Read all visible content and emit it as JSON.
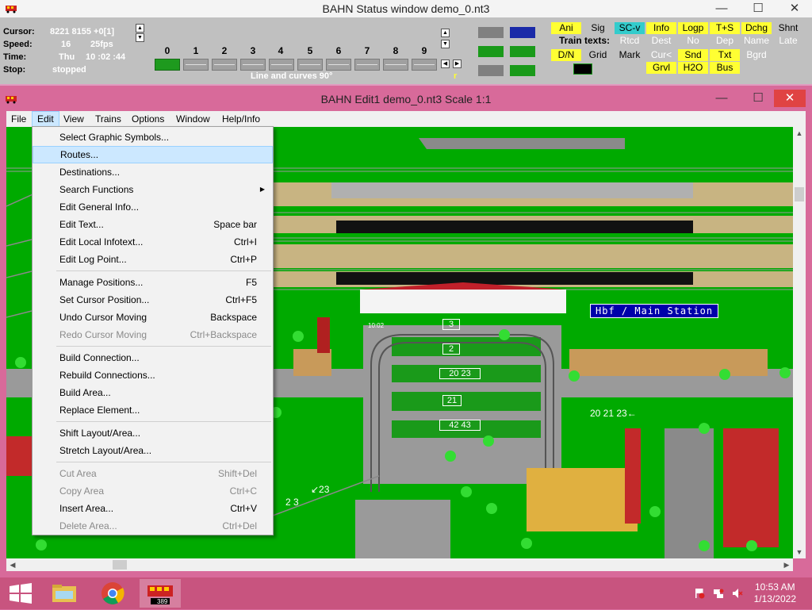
{
  "status_window": {
    "title": "BAHN Status window demo_0.nt3",
    "controls": {
      "minimize": "—",
      "maximize": "☐",
      "close": "✕"
    },
    "cursor_label": "Cursor:",
    "cursor_value": "8221  8155 +0[1]",
    "speed_label": "Speed:",
    "speed_value": "16",
    "fps_value": "25fps",
    "time_label": "Time:",
    "time_day": "Thu",
    "time_value": "10 :02 :44",
    "stop_label": "Stop:",
    "stop_value": "stopped",
    "numbers": [
      "0",
      "1",
      "2",
      "3",
      "4",
      "5",
      "6",
      "7",
      "8",
      "9"
    ],
    "route_desc": "Line and curves 90°",
    "r_mark": "r",
    "toggles": {
      "ani": "Ani",
      "sig": "Sig",
      "scv": "SC-v",
      "info": "Info",
      "logp": "Logp",
      "ts": "T+S",
      "dchg": "Dchg",
      "shnt": "Shnt",
      "train_texts": "Train texts:",
      "rtcd": "Rtcd",
      "dest": "Dest",
      "no": "No",
      "dep": "Dep",
      "name": "Name",
      "late": "Late",
      "dn": "D/N",
      "grid": "Grid",
      "mark": "Mark",
      "curl": "Cur<",
      "snd": "Snd",
      "txt": "Txt",
      "bgrd": "Bgrd",
      "grvl": "Grvl",
      "h2o": "H2O",
      "bus": "Bus"
    }
  },
  "edit_window": {
    "title": "BAHN Edit1 demo_0.nt3 Scale 1:1",
    "controls": {
      "minimize": "—",
      "maximize": "☐",
      "close": "✕"
    },
    "menu": [
      "File",
      "Edit",
      "View",
      "Trains",
      "Options",
      "Window",
      "Help/Info"
    ],
    "canvas": {
      "station_label": "Hbf / Main Station",
      "time_small": "10:02",
      "track_numbers": [
        "3",
        "2",
        "20 23",
        "21",
        "42 43"
      ],
      "side_label": "20  21  23←",
      "bottom_label1": "2  3",
      "bottom_label2": "↙23"
    }
  },
  "edit_menu": {
    "items": [
      {
        "label": "Select Graphic Symbols...",
        "shortcut": ""
      },
      {
        "label": "Routes...",
        "shortcut": ""
      },
      {
        "label": "Destinations...",
        "shortcut": ""
      },
      {
        "label": "Search Functions",
        "shortcut": ""
      },
      {
        "label": "Edit General Info...",
        "shortcut": ""
      },
      {
        "label": "Edit Text...",
        "shortcut": "Space bar"
      },
      {
        "label": "Edit Local Infotext...",
        "shortcut": "Ctrl+I"
      },
      {
        "label": "Edit Log Point...",
        "shortcut": "Ctrl+P"
      },
      {
        "label": "Manage Positions...",
        "shortcut": "F5"
      },
      {
        "label": "Set Cursor Position...",
        "shortcut": "Ctrl+F5"
      },
      {
        "label": "Undo Cursor Moving",
        "shortcut": "Backspace"
      },
      {
        "label": "Redo Cursor Moving",
        "shortcut": "Ctrl+Backspace"
      },
      {
        "label": "Build Connection...",
        "shortcut": ""
      },
      {
        "label": "Rebuild Connections...",
        "shortcut": ""
      },
      {
        "label": "Build Area...",
        "shortcut": ""
      },
      {
        "label": "Replace Element...",
        "shortcut": ""
      },
      {
        "label": "Shift Layout/Area...",
        "shortcut": ""
      },
      {
        "label": "Stretch Layout/Area...",
        "shortcut": ""
      },
      {
        "label": "Cut Area",
        "shortcut": "Shift+Del"
      },
      {
        "label": "Copy Area",
        "shortcut": "Ctrl+C"
      },
      {
        "label": "Insert Area...",
        "shortcut": "Ctrl+V"
      },
      {
        "label": "Delete Area...",
        "shortcut": "Ctrl+Del"
      }
    ]
  },
  "taskbar": {
    "apps": [
      "start-button",
      "file-explorer",
      "chrome",
      "bahn"
    ],
    "bahn_badge": "389",
    "time": "10:53 AM",
    "date": "1/13/2022"
  },
  "colors": {
    "accent_pink": "#d86a9a",
    "grass": "#00aa00",
    "toggle_yellow": "#ffff33",
    "toggle_cyan": "#33cccc",
    "menu_highlight": "#cce8ff"
  }
}
